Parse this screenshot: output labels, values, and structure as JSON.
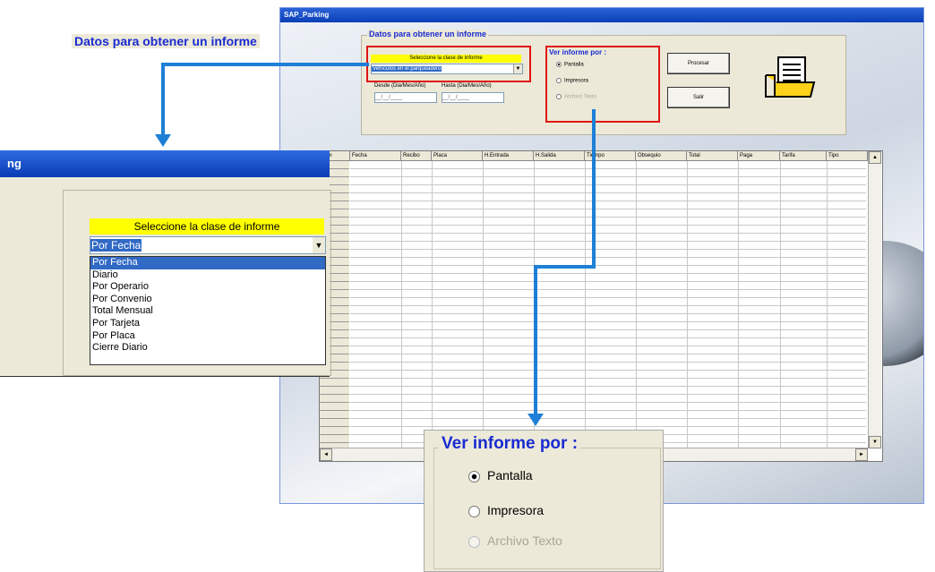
{
  "main_window": {
    "title": "SAP_Parking",
    "group_title": "Datos para obtener un informe",
    "select_label": "Seleccione la clase de informe",
    "select_value": "Vehículos en el parqueadero",
    "desde_label": "Desde (Dia/Mes/Año)",
    "hasta_label": "Hasta (Dia/Mes/Año)",
    "desde_value": "__/__/____",
    "hasta_value": "__/__/____",
    "ver_title": "Ver informe por :",
    "radio_pantalla": "Pantalla",
    "radio_impresora": "Impresora",
    "radio_archivo": "Archivo Texto",
    "procesar_label": "Procesar",
    "salir_label": "Salir"
  },
  "grid": {
    "columns": [
      "Item",
      "Fecha",
      "Recibo",
      "Placa",
      "H.Entrada",
      "H.Salida",
      "Tiempo",
      "Obsequio",
      "Total",
      "Paga",
      "Tarifa",
      "Tipo"
    ]
  },
  "zoom_left": {
    "title": "ng",
    "group_title": "Datos para obtener un informe",
    "select_label": "Seleccione la clase de informe",
    "select_value": "Por Fecha",
    "options": [
      "Por Fecha",
      "Diario",
      "Por Operario",
      "Por Convenio",
      "Total Mensual",
      "Por Tarjeta",
      "Por Placa",
      "Cierre Diario"
    ]
  },
  "zoom_bottom": {
    "title": "Ver informe por :",
    "radio_pantalla": "Pantalla",
    "radio_impresora": "Impresora",
    "radio_archivo": "Archivo Texto"
  },
  "colors": {
    "accent": "#1a2bd1",
    "highlight": "#e01414",
    "arrow": "#1e7fd6",
    "select_bg": "#ffff00"
  }
}
